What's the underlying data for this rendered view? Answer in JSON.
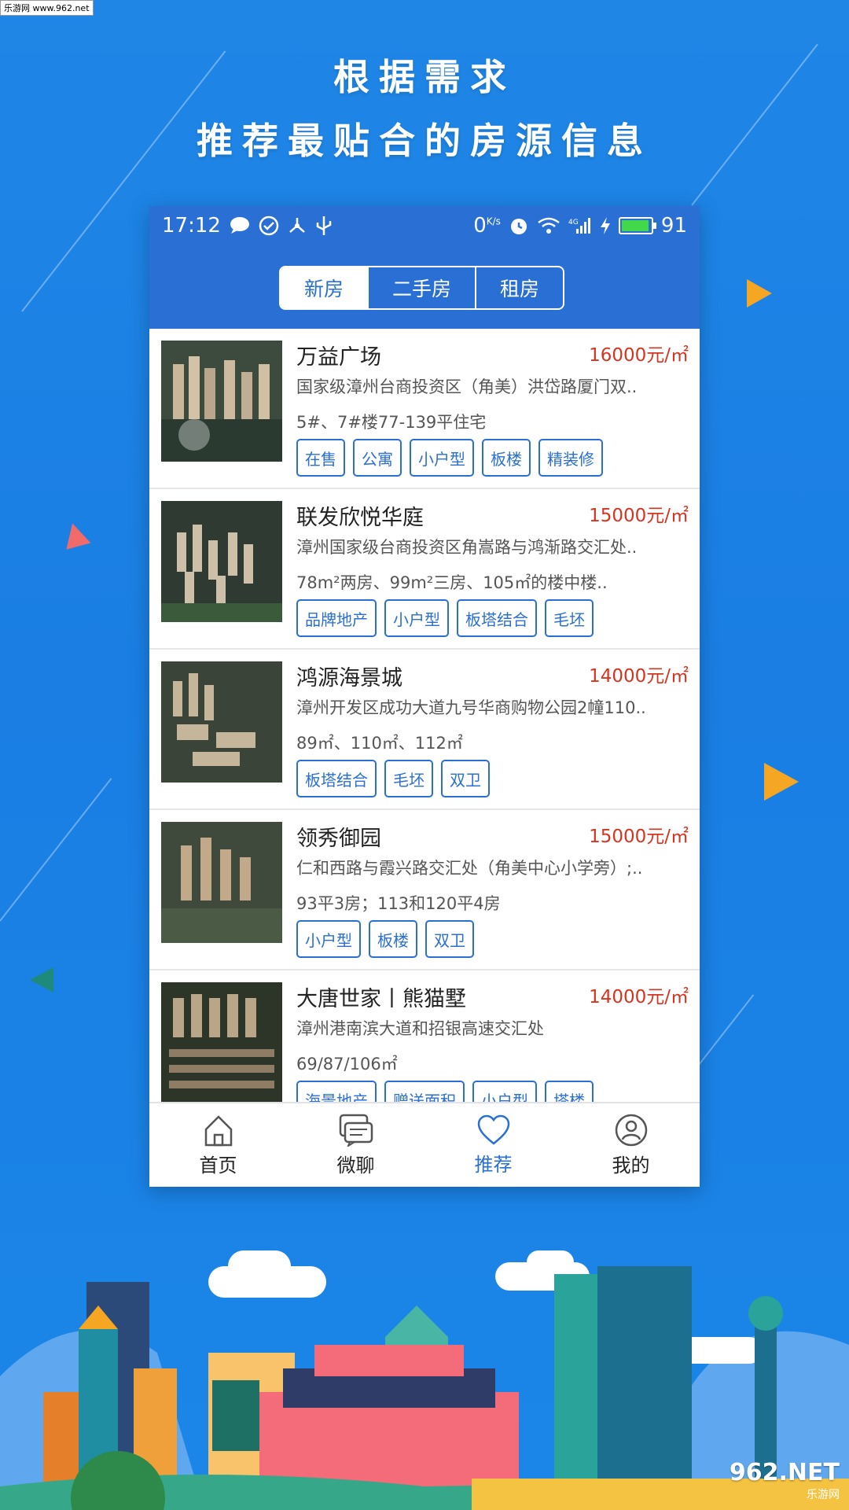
{
  "watermark": "乐游网 www.962.net",
  "headline": {
    "line1": "根据需求",
    "line2": "推荐最贴合的房源信息"
  },
  "status_bar": {
    "time": "17:12",
    "net_speed": "0",
    "net_unit": "K/s",
    "battery": "91"
  },
  "segments": [
    {
      "label": "新房",
      "active": true
    },
    {
      "label": "二手房",
      "active": false
    },
    {
      "label": "租房",
      "active": false
    }
  ],
  "listings": [
    {
      "title": "万益广场",
      "price": "16000元/㎡",
      "address": "国家级漳州台商投资区（角美）洪岱路厦门双..",
      "spec": "5#、7#楼77-139平住宅",
      "tags": [
        "在售",
        "公寓",
        "小户型",
        "板楼",
        "精装修"
      ]
    },
    {
      "title": "联发欣悦华庭",
      "price": "15000元/㎡",
      "address": "漳州国家级台商投资区角嵩路与鸿渐路交汇处..",
      "spec": "78m²两房、99m²三房、105㎡的楼中楼..",
      "tags": [
        "品牌地产",
        "小户型",
        "板塔结合",
        "毛坯"
      ]
    },
    {
      "title": "鸿源海景城",
      "price": "14000元/㎡",
      "address": " 漳州开发区成功大道九号华商购物公园2幢110..",
      "spec": "89㎡、110㎡、112㎡",
      "tags": [
        "板塔结合",
        "毛坯",
        "双卫"
      ]
    },
    {
      "title": "领秀御园",
      "price": "15000元/㎡",
      "address": "仁和西路与霞兴路交汇处（角美中心小学旁）;..",
      "spec": "93平3房；113和120平4房",
      "tags": [
        "小户型",
        "板楼",
        "双卫"
      ]
    },
    {
      "title": "大唐世家丨熊猫墅",
      "price": "14000元/㎡",
      "address": "漳州港南滨大道和招银高速交汇处",
      "spec": "69/87/106㎡",
      "tags": [
        "海景地产",
        "赠送面积",
        "小户型",
        "塔楼"
      ]
    }
  ],
  "tabbar": [
    {
      "label": "首页",
      "icon": "home-icon",
      "active": false
    },
    {
      "label": "微聊",
      "icon": "chat-icon",
      "active": false
    },
    {
      "label": "推荐",
      "icon": "heart-icon",
      "active": true
    },
    {
      "label": "我的",
      "icon": "profile-icon",
      "active": false
    }
  ],
  "colors": {
    "accent": "#2a6fd3",
    "price": "#d8331f",
    "background": "#1f86e6"
  },
  "footer_logo": {
    "text": "962.NET",
    "sub": "乐游网"
  }
}
